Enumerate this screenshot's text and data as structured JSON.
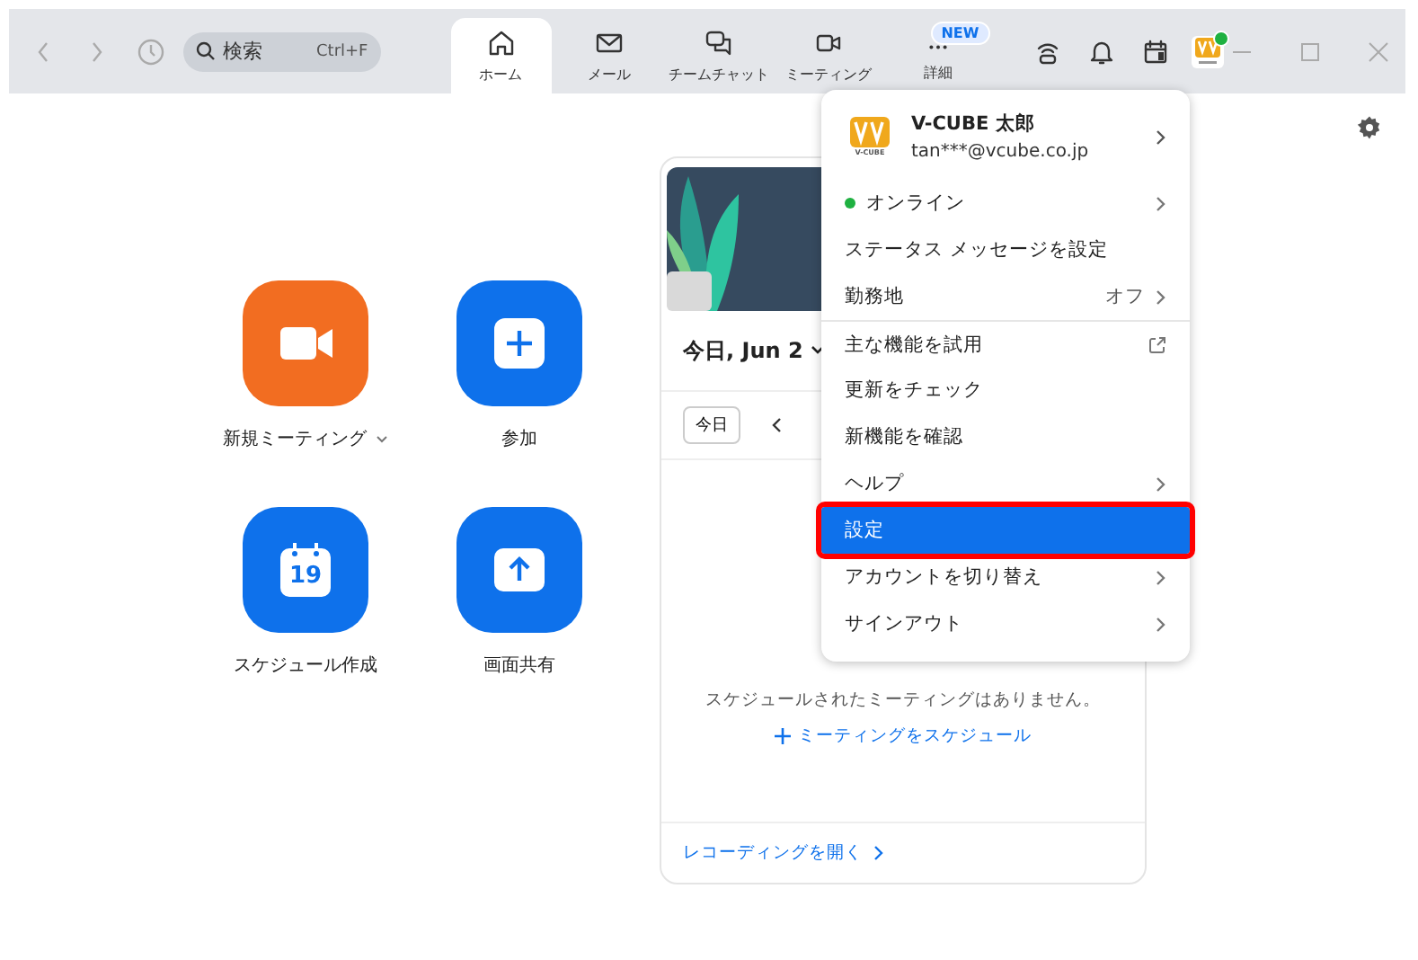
{
  "toolbar": {
    "search": {
      "placeholder": "検索",
      "shortcut": "Ctrl+F"
    },
    "tabs": [
      {
        "label": "ホーム",
        "selected": true
      },
      {
        "label": "メール",
        "selected": false
      },
      {
        "label": "チームチャット",
        "selected": false
      },
      {
        "label": "ミーティング",
        "selected": false
      },
      {
        "label": "詳細",
        "selected": false,
        "badge": "NEW"
      }
    ],
    "avatar": {
      "online": true
    }
  },
  "actions": [
    {
      "label": "新規ミーティング",
      "kind": "video",
      "color": "#f26d21",
      "dropdown": true
    },
    {
      "label": "参加",
      "kind": "plus",
      "color": "#0e71eb",
      "dropdown": false
    },
    {
      "label": "スケジュール作成",
      "kind": "calendar",
      "color": "#0e71eb",
      "dropdown": false,
      "day": "19"
    },
    {
      "label": "画面共有",
      "kind": "share",
      "color": "#0e71eb",
      "dropdown": false
    }
  ],
  "calendar": {
    "date": "今日, Jun 2",
    "today_button": "今日",
    "empty_message": "スケジュールされたミーティングはありません。",
    "schedule_link": "ミーティングをスケジュール",
    "recordings_link": "レコーディングを開く"
  },
  "menu": {
    "profile": {
      "logo_caption": "V-CUBE",
      "name": "V-CUBE 太郎",
      "email": "tan***@vcube.co.jp"
    },
    "items": [
      {
        "label": "オンライン",
        "kind": "status",
        "color": "#1fb141",
        "selected": false,
        "submenu": true
      },
      {
        "label": "ステータス メッセージを設定",
        "kind": "plain",
        "selected": false,
        "submenu": false
      },
      {
        "label": "勤務地",
        "kind": "value",
        "value": "オフ",
        "selected": false,
        "submenu": true
      },
      {
        "label": "主な機能を試用",
        "kind": "external",
        "selected": false,
        "submenu": false,
        "divider_before": true
      },
      {
        "label": "更新をチェック",
        "kind": "plain",
        "selected": false,
        "submenu": false
      },
      {
        "label": "新機能を確認",
        "kind": "plain",
        "selected": false,
        "submenu": false
      },
      {
        "label": "ヘルプ",
        "kind": "plain",
        "selected": false,
        "submenu": true
      },
      {
        "label": "設定",
        "kind": "plain",
        "selected": true,
        "submenu": false
      },
      {
        "label": "アカウントを切り替え",
        "kind": "plain",
        "selected": false,
        "submenu": true
      },
      {
        "label": "サインアウト",
        "kind": "plain",
        "selected": false,
        "submenu": true
      }
    ]
  }
}
